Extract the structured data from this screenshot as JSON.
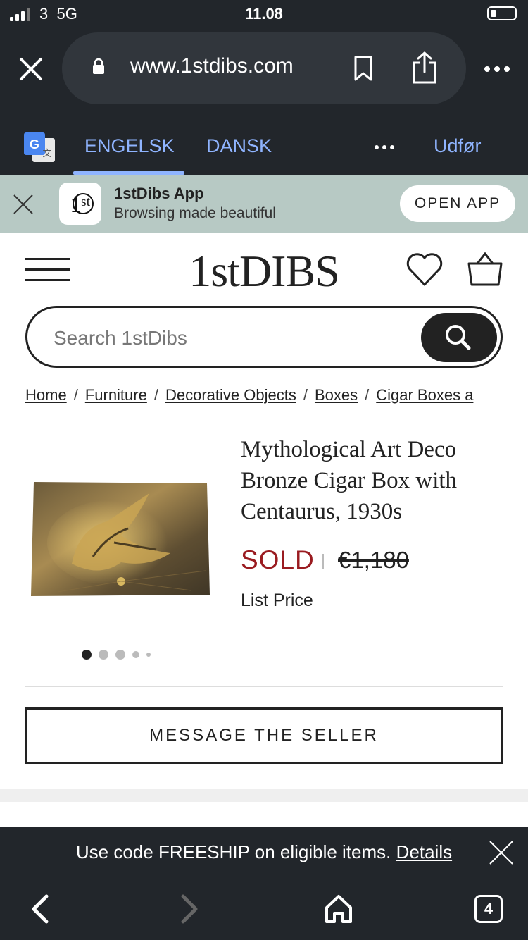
{
  "status_bar": {
    "carrier": "3  5G",
    "time": "11.08"
  },
  "browser": {
    "url": "www.1stdibs.com",
    "icons": [
      "close-icon",
      "lock-icon",
      "bookmark-icon",
      "share-icon",
      "more-icon"
    ]
  },
  "translate_bar": {
    "languages": [
      "ENGELSK",
      "DANSK"
    ],
    "active": "ENGELSK",
    "done_label": "Udfør"
  },
  "app_banner": {
    "title": "1stDibs App",
    "subtitle": "Browsing made beautiful",
    "button": "OPEN APP"
  },
  "header": {
    "logo_text": "1stDIBS"
  },
  "search": {
    "placeholder": "Search 1stDibs"
  },
  "breadcrumb": [
    "Home",
    "Furniture",
    "Decorative Objects",
    "Boxes",
    "Cigar Boxes a"
  ],
  "product": {
    "title": "Mythological Art Deco Bronze Cigar Box with Centaurus, 1930s",
    "status": "SOLD",
    "price": "€1,180",
    "price_label": "List Price",
    "image_count": 5,
    "active_image": 1
  },
  "message_button": "MESSAGE THE SELLER",
  "promo": {
    "text": "Use code FREESHIP on eligible items.",
    "link": "Details"
  },
  "bottom_nav": {
    "tabs_count": "4"
  },
  "colors": {
    "chrome": "#22262b",
    "translate_accent": "#8fb4ff",
    "banner_bg": "#b7c9c4",
    "sold": "#9a1b20"
  }
}
